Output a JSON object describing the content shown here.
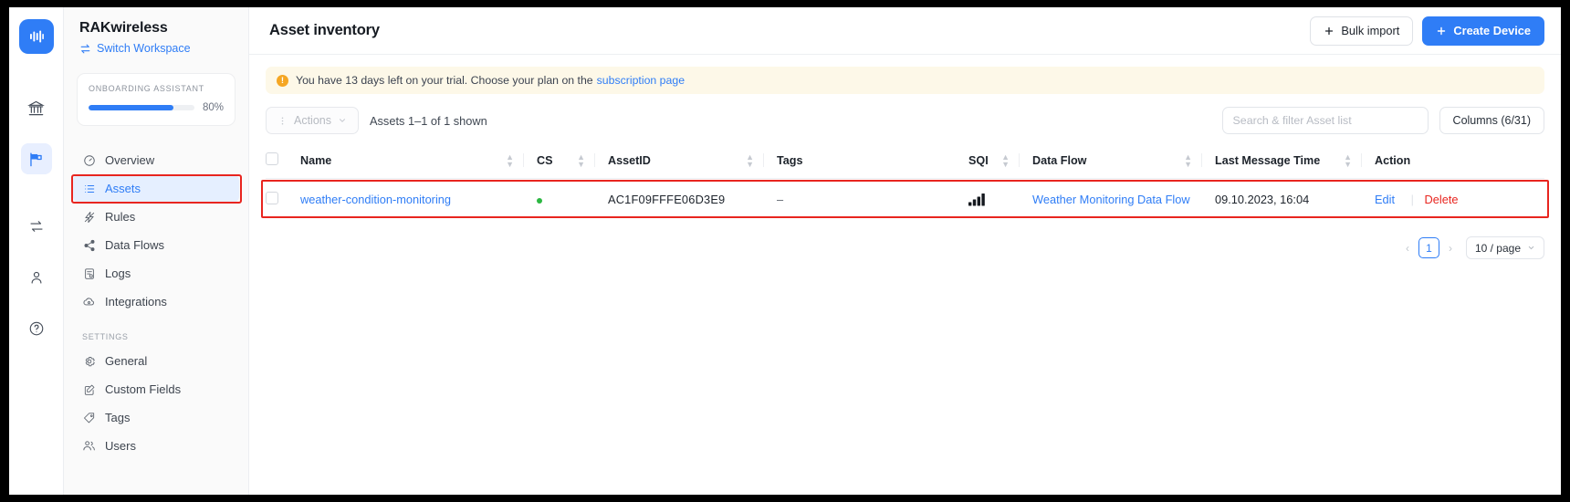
{
  "rail": {
    "logo_icon": "audio-waveform-logo",
    "items": [
      {
        "icon": "bank-icon",
        "name": "organization",
        "active": false
      },
      {
        "icon": "flag-icon",
        "name": "workspace",
        "active": true
      },
      {
        "icon": "swap-icon",
        "name": "transfer",
        "active": false
      },
      {
        "icon": "user-icon",
        "name": "account",
        "active": false
      },
      {
        "icon": "help-circle-icon",
        "name": "help",
        "active": false
      }
    ]
  },
  "sidebar": {
    "workspace_name": "RAKwireless",
    "switch_workspace": "Switch Workspace",
    "onboarding": {
      "label": "ONBOARDING ASSISTANT",
      "percent_text": "80%",
      "percent_value": 80
    },
    "items": [
      {
        "label": "Overview",
        "icon": "gauge-icon",
        "active": false
      },
      {
        "label": "Assets",
        "icon": "list-icon",
        "active": true
      },
      {
        "label": "Rules",
        "icon": "bolt-icon",
        "active": false
      },
      {
        "label": "Data Flows",
        "icon": "share-icon",
        "active": false
      },
      {
        "label": "Logs",
        "icon": "log-icon",
        "active": false
      },
      {
        "label": "Integrations",
        "icon": "cloud-icon",
        "active": false
      }
    ],
    "settings_label": "SETTINGS",
    "settings_items": [
      {
        "label": "General",
        "icon": "gear-icon"
      },
      {
        "label": "Custom Fields",
        "icon": "edit-square-icon"
      },
      {
        "label": "Tags",
        "icon": "tag-icon"
      },
      {
        "label": "Users",
        "icon": "users-icon"
      }
    ]
  },
  "header": {
    "title": "Asset inventory",
    "bulk_import": "Bulk import",
    "create_device": "Create Device"
  },
  "banner": {
    "icon": "warning-icon",
    "text": "You have 13 days left on your trial. Choose your plan on the ",
    "link_text": "subscription page"
  },
  "toolbar": {
    "actions_label": "Actions",
    "actions_icon": "kebab-icon",
    "actions_chevron": "chevron-down-icon",
    "count_text": "Assets 1–1 of 1 shown",
    "search_placeholder": "Search & filter Asset list",
    "columns_label": "Columns (6/31)"
  },
  "table": {
    "columns": [
      {
        "label": "Name",
        "sortable": true
      },
      {
        "label": "CS",
        "sortable": true
      },
      {
        "label": "AssetID",
        "sortable": true
      },
      {
        "label": "Tags",
        "sortable": false
      },
      {
        "label": "SQI",
        "sortable": true
      },
      {
        "label": "Data Flow",
        "sortable": true
      },
      {
        "label": "Last Message Time",
        "sortable": true
      },
      {
        "label": "Action",
        "sortable": false
      }
    ],
    "rows": [
      {
        "name": "weather-condition-monitoring",
        "cs": "online",
        "asset_id": "AC1F09FFFE06D3E9",
        "tags": "–",
        "sqi": "signal-bars-icon",
        "data_flow": "Weather Monitoring Data Flow",
        "last_message_time": "09.10.2023, 16:04",
        "action_edit": "Edit",
        "action_delete": "Delete"
      }
    ]
  },
  "pagination": {
    "prev": "‹",
    "page": "1",
    "next": "›",
    "page_size": "10 / page"
  },
  "colors": {
    "accent": "#2f7df6",
    "highlight": "#e8251f",
    "status_online": "#2cb742",
    "banner_bg": "#fdf8e8",
    "warn": "#f5a623"
  }
}
